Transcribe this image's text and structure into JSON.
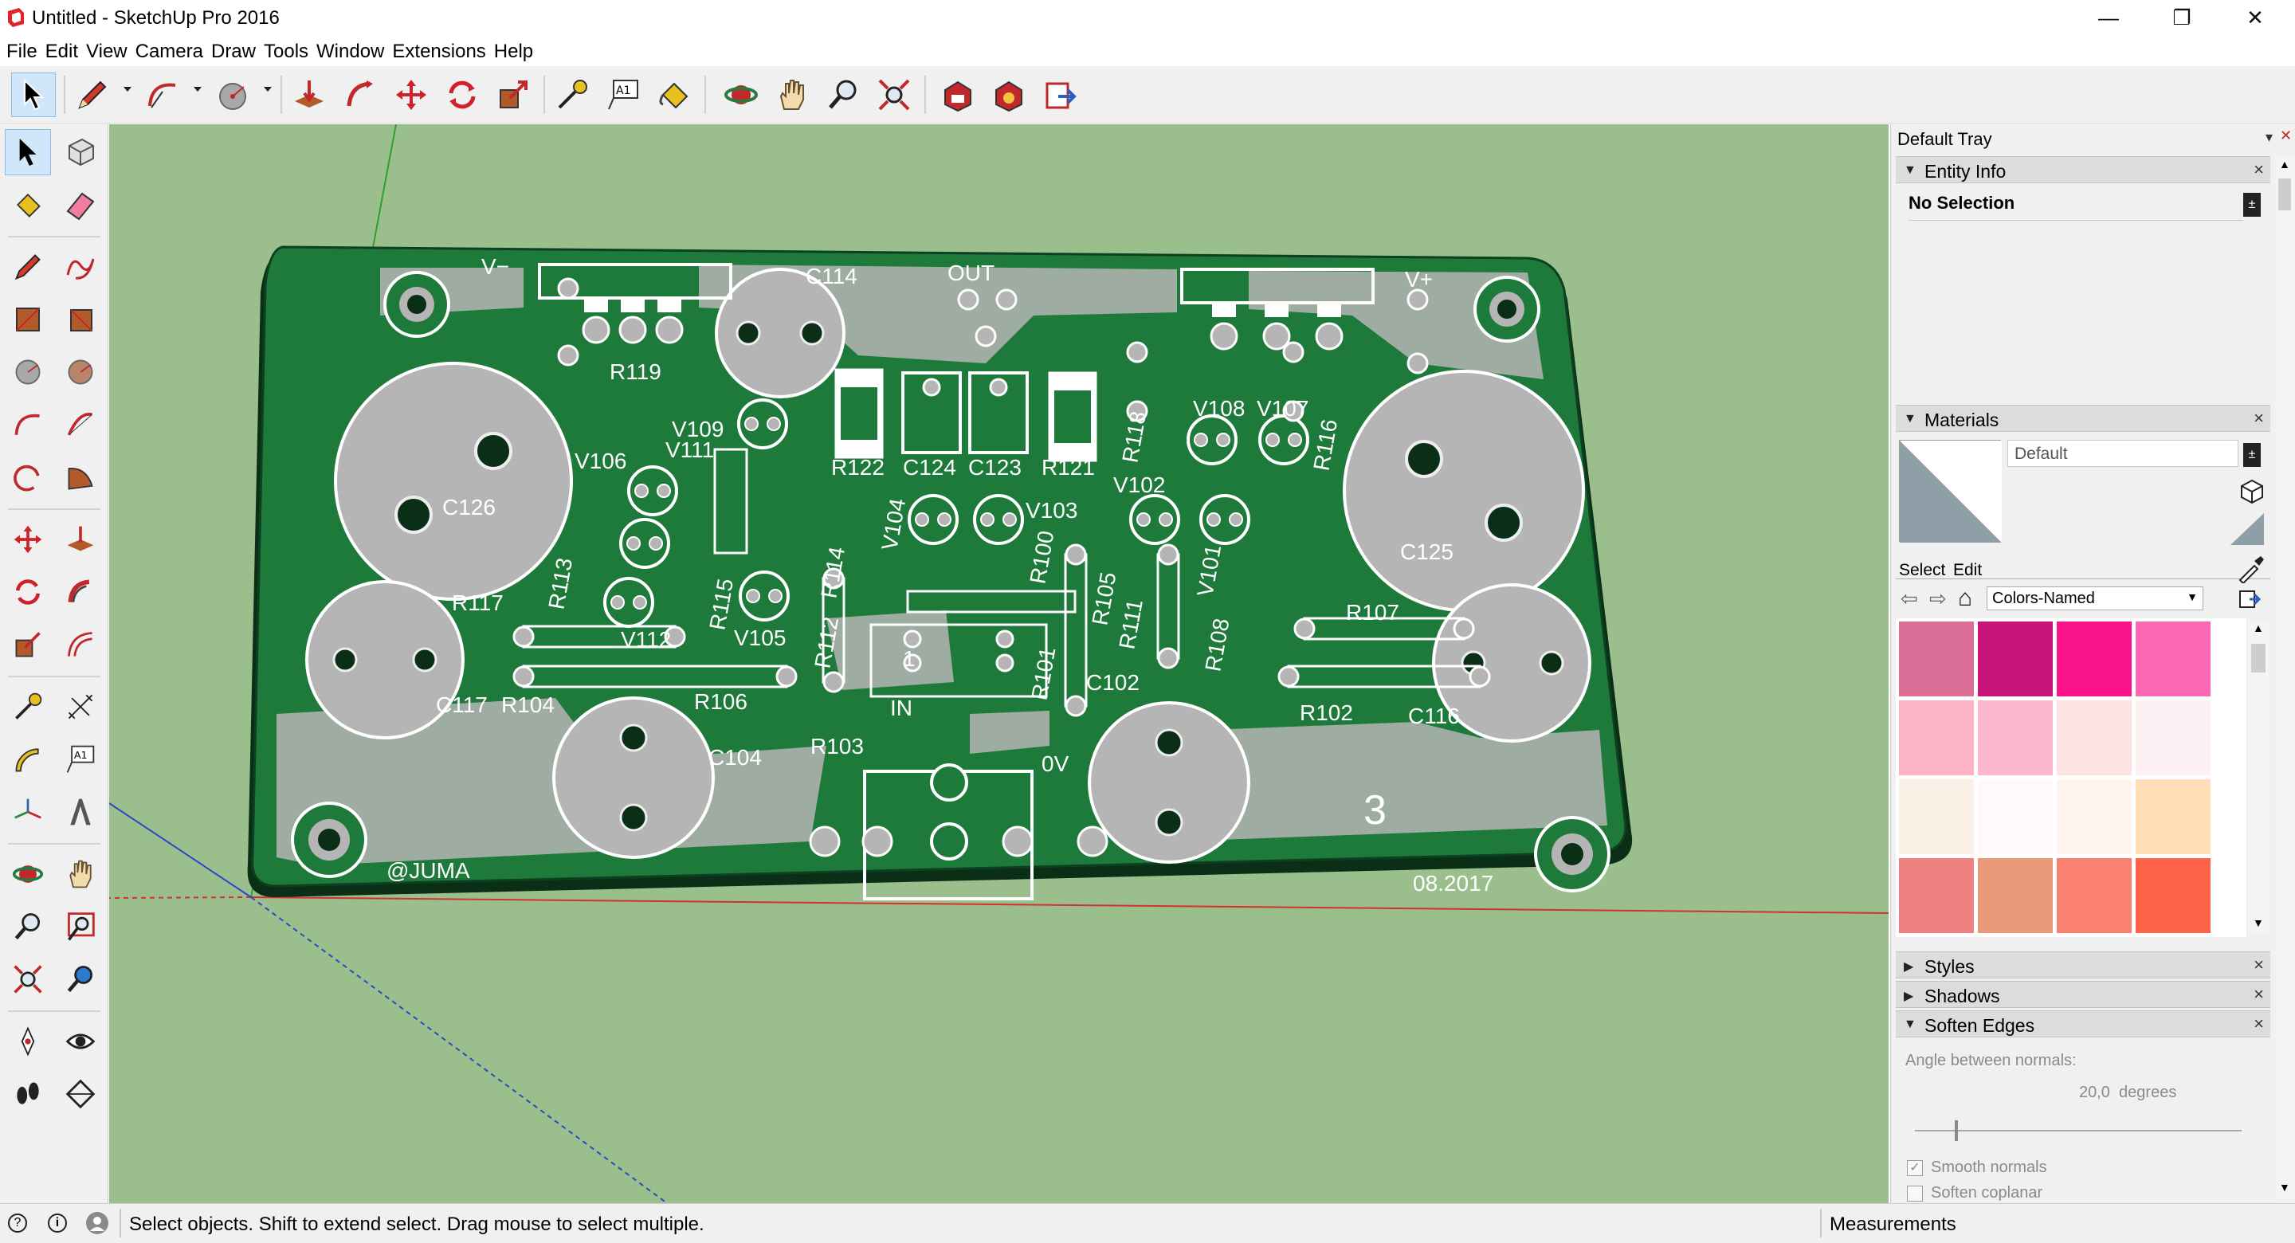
{
  "app": {
    "title": "Untitled - SketchUp Pro 2016",
    "minimize_glyph": "—",
    "restore_glyph": "❐",
    "close_glyph": "✕"
  },
  "menu": [
    "File",
    "Edit",
    "View",
    "Camera",
    "Draw",
    "Tools",
    "Window",
    "Extensions",
    "Help"
  ],
  "toolbar_icons": [
    "select-icon",
    "pencil-icon",
    "arc-icon",
    "circle-icon",
    "push-pull-icon",
    "follow-me-icon",
    "move-icon",
    "rotate-icon",
    "scale-icon",
    "tape-measure-icon",
    "text-icon",
    "paint-bucket-icon",
    "orbit-icon",
    "pan-icon",
    "zoom-icon",
    "zoom-extents-icon",
    "warehouse-icon",
    "extension-warehouse-icon",
    "layout-icon"
  ],
  "model": {
    "labels": [
      "V−",
      "V+",
      "OUT",
      "C114",
      "R119",
      "V109",
      "V111",
      "V106",
      "C126",
      "R113",
      "R117",
      "V112",
      "R115",
      "V105",
      "R112",
      "R114",
      "R122",
      "C124",
      "C123",
      "R121",
      "V104",
      "V103",
      "R100",
      "R105",
      "R111",
      "R101",
      "C102",
      "V102",
      "V101",
      "R108",
      "V108",
      "V107",
      "R118",
      "R116",
      "R107",
      "C125",
      "C116",
      "R102",
      "C117",
      "R104",
      "R106",
      "C104",
      "R103",
      "IN",
      "0V",
      "1",
      "3",
      "@JUMA",
      "08.2017"
    ]
  },
  "tray": {
    "title": "Default Tray",
    "entity_info": {
      "header": "Entity Info",
      "selection": "No Selection"
    },
    "materials": {
      "header": "Materials",
      "material_name": "Default",
      "tab_select": "Select",
      "tab_edit": "Edit",
      "library": "Colors-Named",
      "swatches": [
        "#dc6f97",
        "#c8137b",
        "#fb138b",
        "#fd68b3",
        "#fdb3c6",
        "#fcb8cc",
        "#fde3e1",
        "#fdf1f4",
        "#faf0e6",
        "#fffafa",
        "#fff4ed",
        "#ffdeb8",
        "#ef8080",
        "#ea987a",
        "#fa8072",
        "#ff6347"
      ]
    },
    "styles_header": "Styles",
    "shadows_header": "Shadows",
    "soften": {
      "header": "Soften Edges",
      "angle_label": "Angle between normals:",
      "angle_value": "20,0  degrees",
      "smooth_normals": "Smooth normals",
      "soften_coplanar": "Soften coplanar",
      "smooth_checked": true,
      "coplanar_checked": false
    }
  },
  "status": {
    "message": "Select objects. Shift to extend select. Drag mouse to select multiple.",
    "measurements_label": "Measurements"
  }
}
